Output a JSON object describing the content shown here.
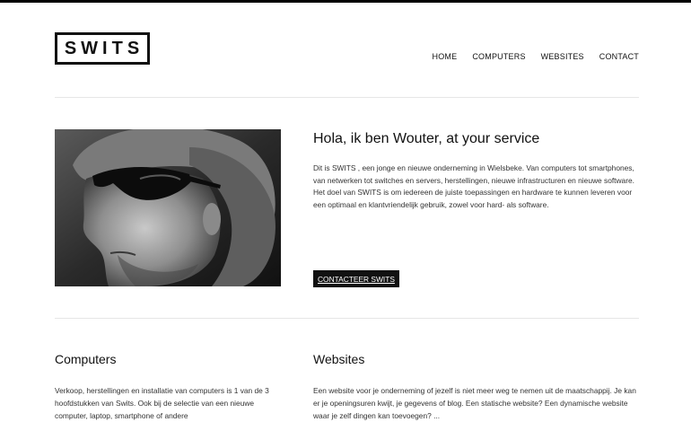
{
  "header": {
    "logo_text": "SWITS",
    "nav": [
      {
        "label": "HOME"
      },
      {
        "label": "COMPUTERS"
      },
      {
        "label": "WEBSITES"
      },
      {
        "label": "CONTACT"
      }
    ]
  },
  "hero": {
    "title": "Hola, ik ben Wouter, at your service",
    "text": "Dit is SWITS , een jonge en nieuwe onderneming in Wielsbeke. Van computers tot smartphones, van netwerken tot switches en servers, herstellingen, nieuwe infrastructuren en nieuwe software. Het doel van SWITS is om iedereen de juiste toepassingen en hardware te kunnen leveren voor een optimaal en klantvriendelijk gebruik, zowel voor hard- als software.",
    "cta_label": "CONTACTEER SWITS"
  },
  "sections": {
    "computers": {
      "title": "Computers",
      "text": "Verkoop, herstellingen en installatie van computers is 1 van de 3 hoofdstukken van Swits. Ook bij de selectie van een nieuwe computer, laptop, smartphone of andere"
    },
    "websites": {
      "title": "Websites",
      "text": "Een website voor je onderneming of jezelf is niet meer weg te nemen uit de maatschappij. Je kan er je openingsuren kwijt, je gegevens of blog. Een statische website? Een dynamische website waar je zelf dingen kan toevoegen? ..."
    }
  },
  "colors": {
    "accent": "#111111",
    "rule": "#e6e6e6"
  }
}
